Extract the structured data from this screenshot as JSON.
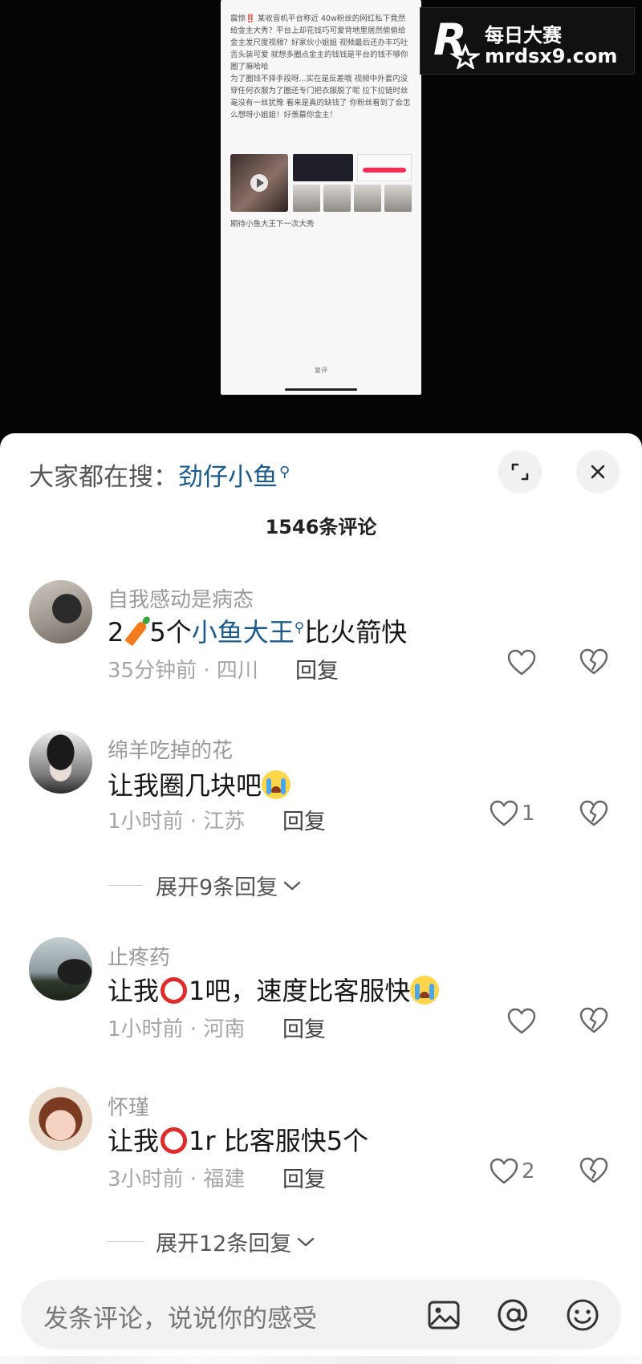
{
  "video": {
    "post_text_1": "震惊‼️ 某收音机平台称近 40w粉丝的网红私下竟然给金主大秀？平台上却花钱巧可爱背地里居然偷偷给金主发尺度视频？好家伙小姐姐 视频最后还办丰巧吐舌头装可爱 就想多圈点金主的钱钱是平台的钱不够你圈了嘛哈哈",
    "post_text_2": "为了圈钱不择手段呀...实在是反差哦 视频中外套内没穿任何衣服为了圈还专门把衣服脱了呢 拉下拉链时丝毫没有一丝犹豫 看来是真的缺钱了 你粉丝看到了会怎么想呀小姐姐！好羡慕你金主！",
    "closing_line": "期待小鱼大王下一次大秀",
    "bottom_label": "复评"
  },
  "watermark": {
    "title": "每日大赛",
    "url": "mrdsx9.com",
    "logo_letter": "R"
  },
  "sheet": {
    "search_prefix": "大家都在搜：",
    "search_term": "劲仔小鱼",
    "comment_count": "1546条评论"
  },
  "comments": [
    {
      "username": "自我感动是病态",
      "text_a": "2",
      "text_b": "5个",
      "link": "小鱼大王",
      "text_c": "比火箭快",
      "time_location": "35分钟前 · 四川",
      "reply_label": "回复",
      "likes": ""
    },
    {
      "username": "绵羊吃掉的花",
      "text_a": "让我圈几块吧",
      "time_location": "1小时前 · 江苏",
      "reply_label": "回复",
      "likes": "1",
      "expand_label": "展开9条回复"
    },
    {
      "username": "止疼药",
      "text_a": "让我",
      "text_b": "1吧，速度比客服快",
      "time_location": "1小时前 · 河南",
      "reply_label": "回复",
      "likes": ""
    },
    {
      "username": "怀瑾",
      "text_a": "让我",
      "text_b": "1r  比客服快5个",
      "time_location": "3小时前 · 福建",
      "reply_label": "回复",
      "likes": "2",
      "expand_label": "展开12条回复"
    }
  ],
  "input": {
    "placeholder": "发条评论，说说你的感受"
  },
  "icons": {
    "expand": "expand-icon",
    "close": "close-icon",
    "like": "heart-icon",
    "dislike": "broken-heart-icon",
    "image": "image-icon",
    "mention": "at-icon",
    "emoji": "emoji-icon"
  },
  "colors": {
    "link": "#1b5a8c",
    "sheet_bg": "#ffffff",
    "muted_text": "#9a9a9a"
  }
}
